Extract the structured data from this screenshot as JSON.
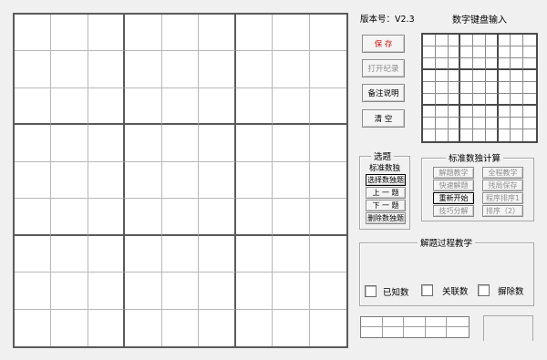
{
  "version": {
    "label": "版本号：V2.3"
  },
  "keypad": {
    "title": "数字键盘输入"
  },
  "actions": {
    "save": "保 存",
    "open_record": "打开纪录",
    "notes": "备注说明",
    "clear": "清 空"
  },
  "select_panel": {
    "title": "选题",
    "subtitle": "标准数独",
    "choose": "选择数独题",
    "prev": "上 一 题",
    "next": "下 一 题",
    "delete": "删除数独题"
  },
  "calc_panel": {
    "title": "标准数独计算",
    "buttons": [
      "解题教学",
      "全程教学",
      "快速解题",
      "残局保存",
      "重新开始",
      "程序排序1",
      "技巧分解",
      "排序（2）"
    ]
  },
  "process_panel": {
    "title": "解题过程教学",
    "checkboxes": [
      "已知数",
      "关联数",
      "摒除数"
    ]
  }
}
